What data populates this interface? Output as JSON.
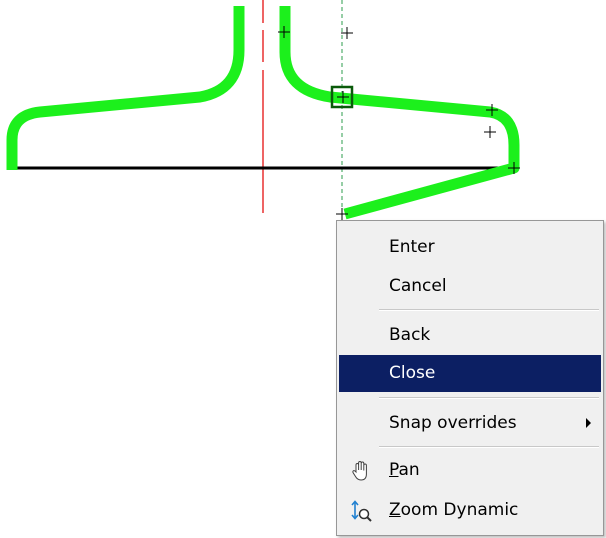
{
  "drawing": {
    "colors": {
      "polyline": "#1cf01c",
      "centerline": "#e83030",
      "guide": "#2e9e4e",
      "baseline": "#000000",
      "crosshair": "#000000",
      "grip": "#0a7a0a"
    }
  },
  "context_menu": {
    "items": [
      {
        "id": "enter",
        "label": "Enter"
      },
      {
        "id": "cancel",
        "label": "Cancel"
      },
      {
        "id": "back",
        "label": "Back"
      },
      {
        "id": "close",
        "label": "Close",
        "highlighted": true
      },
      {
        "id": "snap",
        "label": "Snap overrides",
        "has_submenu": true
      },
      {
        "id": "pan",
        "mnemonic": "P",
        "label_rest": "an",
        "icon": "pan-hand-icon"
      },
      {
        "id": "zoom",
        "mnemonic": "Z",
        "label_rest": "oom Dynamic",
        "icon": "zoom-dynamic-icon"
      }
    ],
    "colors": {
      "background": "#f0f0f0",
      "highlight": "#0c1f63",
      "highlight_text": "#ffffff",
      "border": "#979797"
    }
  }
}
